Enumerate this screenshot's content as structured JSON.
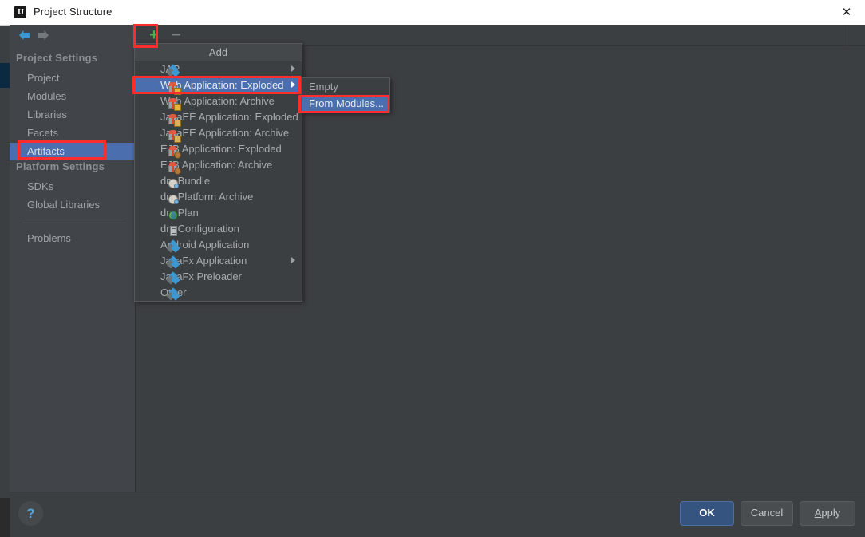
{
  "window": {
    "title": "Project Structure",
    "logo_text": "IJ",
    "close_glyph": "✕"
  },
  "sidebar": {
    "nav": {
      "back_icon": "arrow-left-icon",
      "forward_icon": "arrow-right-icon"
    },
    "sections": [
      {
        "heading": "Project Settings",
        "items": [
          {
            "label": "Project",
            "selected": false
          },
          {
            "label": "Modules",
            "selected": false
          },
          {
            "label": "Libraries",
            "selected": false
          },
          {
            "label": "Facets",
            "selected": false
          },
          {
            "label": "Artifacts",
            "selected": true
          }
        ]
      },
      {
        "heading": "Platform Settings",
        "items": [
          {
            "label": "SDKs",
            "selected": false
          },
          {
            "label": "Global Libraries",
            "selected": false
          }
        ]
      }
    ],
    "problems": {
      "label": "Problems"
    }
  },
  "toolbar": {
    "add_label": "+",
    "remove_label": "−"
  },
  "add_menu": {
    "header": "Add",
    "items": [
      {
        "label": "JAR",
        "icon": "diamond-icon",
        "submenu": true,
        "highlighted": false
      },
      {
        "label": "Web Application: Exploded",
        "icon": "gift-web-icon",
        "submenu": true,
        "highlighted": true
      },
      {
        "label": "Web Application: Archive",
        "icon": "gift-web-icon",
        "submenu": false,
        "highlighted": false
      },
      {
        "label": "JavaEE Application: Exploded",
        "icon": "gift-javaee-icon",
        "submenu": false,
        "highlighted": false
      },
      {
        "label": "JavaEE Application: Archive",
        "icon": "gift-javaee-icon",
        "submenu": false,
        "highlighted": false
      },
      {
        "label": "EJB Application: Exploded",
        "icon": "gift-ejb-icon",
        "submenu": false,
        "highlighted": false
      },
      {
        "label": "EJB Application: Archive",
        "icon": "gift-ejb-icon",
        "submenu": false,
        "highlighted": false
      },
      {
        "label": "dm Bundle",
        "icon": "ball-icon",
        "submenu": false,
        "highlighted": false
      },
      {
        "label": "dm Platform Archive",
        "icon": "ball-icon",
        "submenu": false,
        "highlighted": false
      },
      {
        "label": "dm Plan",
        "icon": "globe-icon",
        "submenu": false,
        "highlighted": false
      },
      {
        "label": "dm Configuration",
        "icon": "document-icon",
        "submenu": false,
        "highlighted": false
      },
      {
        "label": "Android Application",
        "icon": "diamond-icon",
        "submenu": false,
        "highlighted": false
      },
      {
        "label": "JavaFx Application",
        "icon": "diamond-icon",
        "submenu": true,
        "highlighted": false
      },
      {
        "label": "JavaFx Preloader",
        "icon": "diamond-icon",
        "submenu": false,
        "highlighted": false
      },
      {
        "label": "Other",
        "icon": "diamond-icon",
        "submenu": false,
        "highlighted": false
      }
    ]
  },
  "submenu": {
    "items": [
      {
        "label": "Empty",
        "highlighted": false
      },
      {
        "label": "From Modules...",
        "highlighted": true
      }
    ]
  },
  "footer": {
    "help_label": "?",
    "ok_label": "OK",
    "cancel_label": "Cancel",
    "apply_mnemonic": "A",
    "apply_rest": "pply"
  },
  "colors": {
    "accent_selection": "#4b6eaf",
    "annotation": "#fc2d2d",
    "add_plus": "#4caf50",
    "panel_bg": "#3c3f41",
    "sidebar_bg": "#41454a",
    "titlebar_bg": "#ffffff"
  }
}
